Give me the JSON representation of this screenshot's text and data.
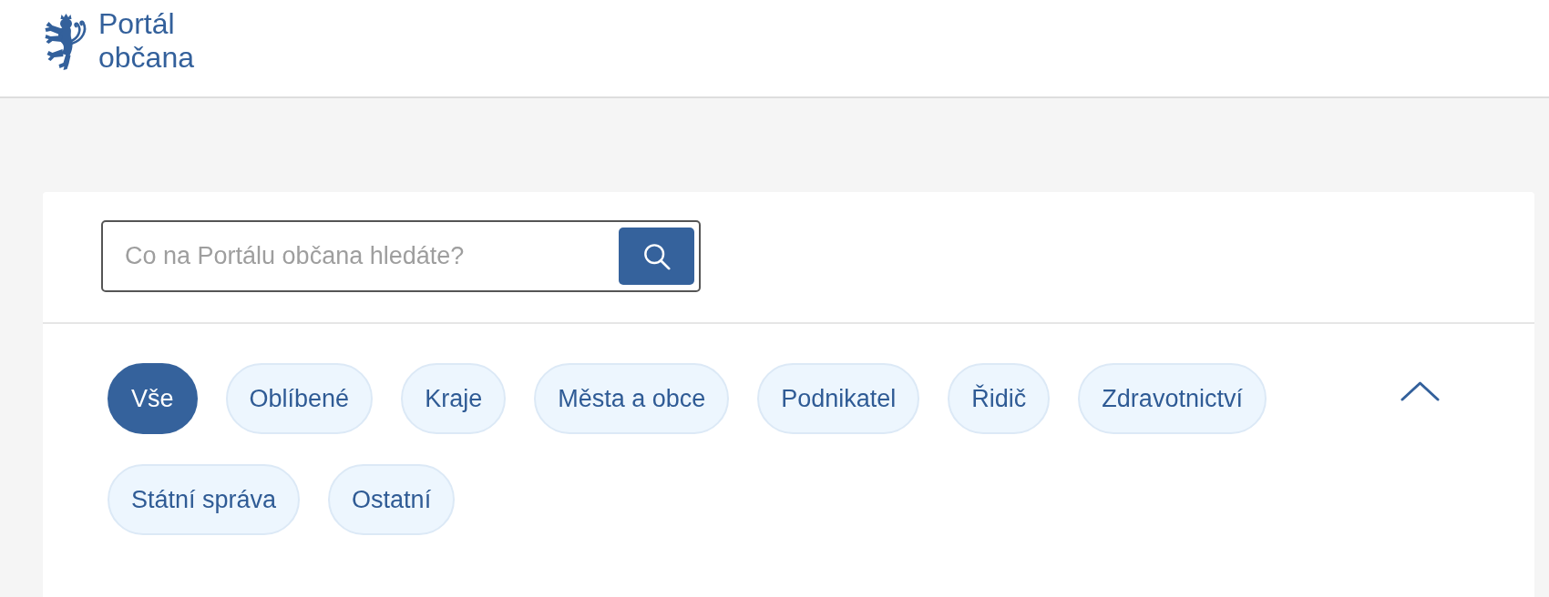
{
  "header": {
    "logo_text": "Portál občana"
  },
  "search": {
    "placeholder": "Co na Portálu občana hledáte?"
  },
  "categories": {
    "expanded": true,
    "chips": [
      {
        "label": "Vše",
        "selected": true
      },
      {
        "label": "Oblíbené",
        "selected": false
      },
      {
        "label": "Kraje",
        "selected": false
      },
      {
        "label": "Města a obce",
        "selected": false
      },
      {
        "label": "Podnikatel",
        "selected": false
      },
      {
        "label": "Řidič",
        "selected": false
      },
      {
        "label": "Zdravotnictví",
        "selected": false
      },
      {
        "label": "Státní správa",
        "selected": false
      },
      {
        "label": "Ostatní",
        "selected": false
      }
    ]
  }
}
